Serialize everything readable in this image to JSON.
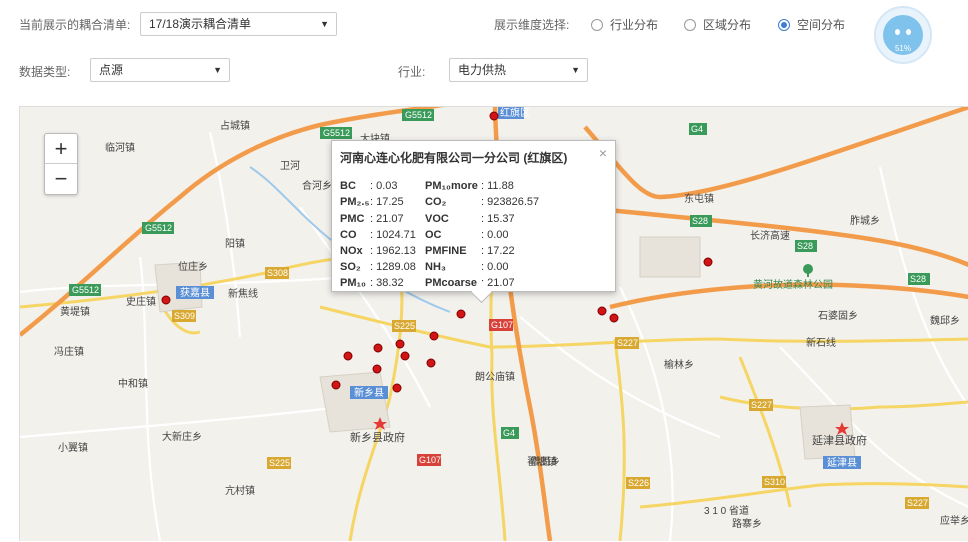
{
  "controls": {
    "coupling_label": "当前展示的耦合清单:",
    "coupling_value": "17/18演示耦合清单",
    "dimension_label": "展示维度选择:",
    "dimension_options": [
      "行业分布",
      "区域分布",
      "空间分布"
    ],
    "dimension_selected": "空间分布",
    "datatype_label": "数据类型:",
    "datatype_value": "点源",
    "industry_label": "行业:",
    "industry_value": "电力供热"
  },
  "badge": {
    "percent": "51%"
  },
  "map": {
    "zoom_in": "+",
    "zoom_out": "−",
    "places": [
      "占城镇",
      "临河镇",
      "大块镇",
      "合河乡",
      "卫河",
      "阳镇",
      "位庄乡",
      "获嘉县",
      "史庄镇",
      "黄堤镇",
      "新焦线",
      "冯庄镇",
      "中和镇",
      "大新庄乡",
      "亢村镇",
      "小翼镇",
      "新乡县",
      "新乡县政府",
      "朗公庙镇",
      "翟坡镇",
      "东屯镇",
      "长济高速",
      "胙城乡",
      "黄河故道森林公园",
      "石婆固乡",
      "魏邱乡",
      "新石线",
      "榆林乡",
      "延津县政府",
      "延津县",
      "僧固乡",
      "3 1 0 省道",
      "路寨乡",
      "应举乡",
      "红旗区",
      "G5512",
      "G4",
      "S28",
      "S308",
      "S309",
      "S225",
      "G107",
      "S227",
      "S226",
      "S310"
    ],
    "park_name": "黄河故道森林公园"
  },
  "popup": {
    "title": "河南心连心化肥有限公司一分公司 (红旗区)",
    "close": "×",
    "left": [
      {
        "k": "BC",
        "v": "0.03"
      },
      {
        "k": "PM₂.₅",
        "v": "17.25"
      },
      {
        "k": "PMC",
        "v": "21.07"
      },
      {
        "k": "CO",
        "v": "1024.71"
      },
      {
        "k": "NOx",
        "v": "1962.13"
      },
      {
        "k": "SO₂",
        "v": "1289.08"
      },
      {
        "k": "PM₁₀",
        "v": "38.32"
      }
    ],
    "right": [
      {
        "k": "PM₁₀more",
        "v": "11.88"
      },
      {
        "k": "CO₂",
        "v": "923826.57"
      },
      {
        "k": "VOC",
        "v": "15.37"
      },
      {
        "k": "OC",
        "v": "0.00"
      },
      {
        "k": "PMFINE",
        "v": "17.22"
      },
      {
        "k": "NH₃",
        "v": "0.00"
      },
      {
        "k": "PMcoarse",
        "v": "21.07"
      }
    ]
  }
}
